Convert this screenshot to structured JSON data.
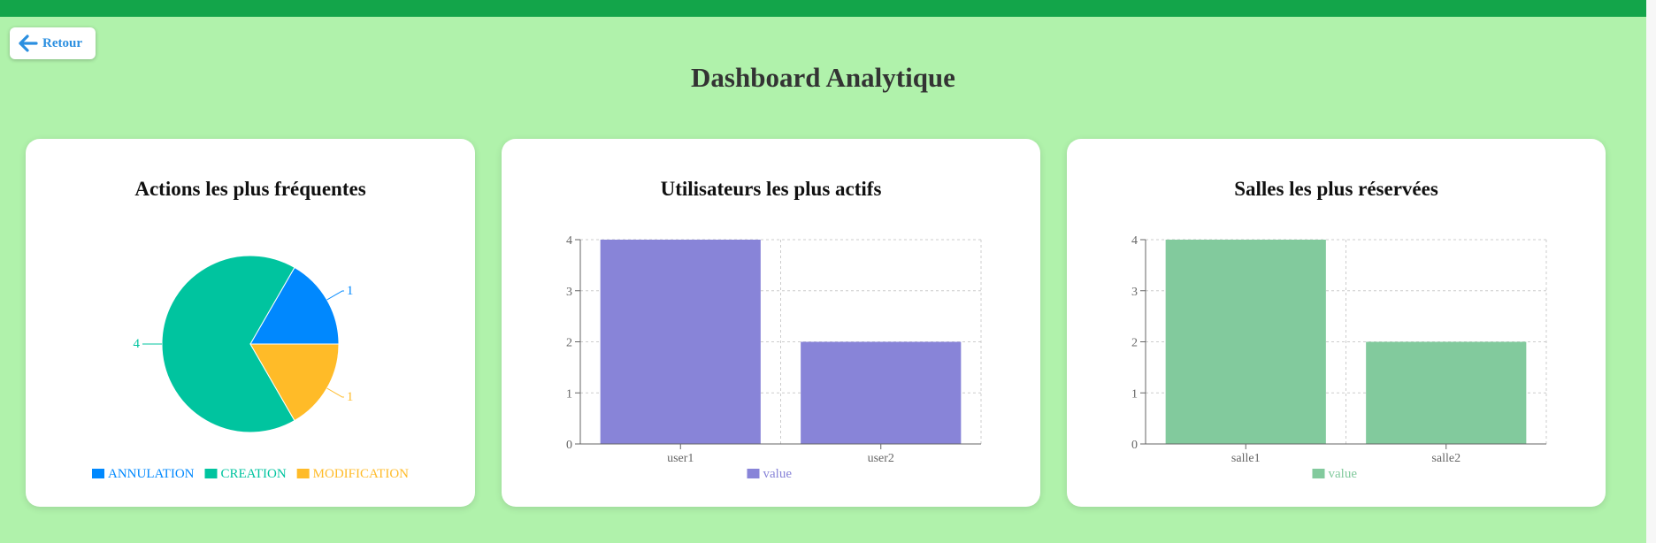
{
  "header": {
    "back_label": "Retour",
    "title": "Dashboard Analytique"
  },
  "colors": {
    "topbar": "#13a54a",
    "background": "#b0f2ab",
    "back_accent": "#2b8fe0",
    "annulation": "#0088fe",
    "creation": "#00c49f",
    "modification": "#ffbb28",
    "users_bar": "#8884d8",
    "rooms_bar": "#82ca9d"
  },
  "cards": [
    {
      "title": "Actions les plus fréquentes"
    },
    {
      "title": "Utilisateurs les plus actifs"
    },
    {
      "title": "Salles les plus réservées"
    }
  ],
  "chart_data": [
    {
      "type": "pie",
      "title": "Actions les plus fréquentes",
      "slices": [
        {
          "label": "ANNULATION",
          "value": 1,
          "color": "#0088fe"
        },
        {
          "label": "CREATION",
          "value": 4,
          "color": "#00c49f"
        },
        {
          "label": "MODIFICATION",
          "value": 1,
          "color": "#ffbb28"
        }
      ],
      "legend": "bottom"
    },
    {
      "type": "bar",
      "title": "Utilisateurs les plus actifs",
      "categories": [
        "user1",
        "user2"
      ],
      "series": [
        {
          "name": "value",
          "values": [
            4,
            2
          ],
          "color": "#8884d8"
        }
      ],
      "ylim": [
        0,
        4
      ],
      "yticks": [
        0,
        1,
        2,
        3,
        4
      ],
      "grid": true,
      "legend": "bottom"
    },
    {
      "type": "bar",
      "title": "Salles les plus réservées",
      "categories": [
        "salle1",
        "salle2"
      ],
      "series": [
        {
          "name": "value",
          "values": [
            4,
            2
          ],
          "color": "#82ca9d"
        }
      ],
      "ylim": [
        0,
        4
      ],
      "yticks": [
        0,
        1,
        2,
        3,
        4
      ],
      "grid": true,
      "legend": "bottom"
    }
  ]
}
